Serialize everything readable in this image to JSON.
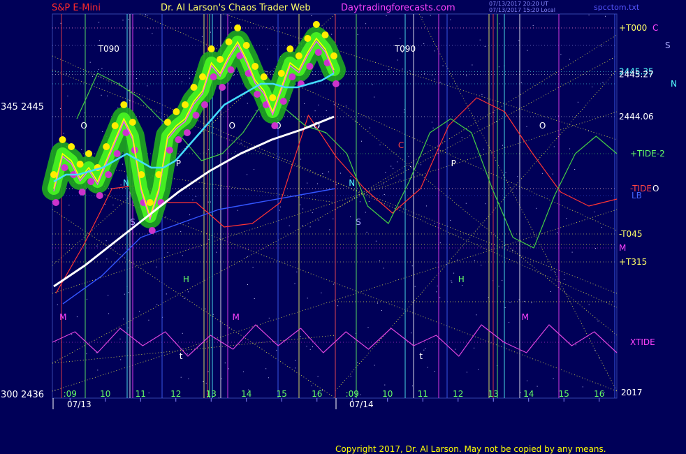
{
  "header": {
    "symbol": "S&P E-Mini",
    "symbol_color": "#ff2a2a",
    "title": "Dr. Al Larson's Chaos Trader Web",
    "title_color": "#ffff66",
    "site": "Daytradingforecasts.com",
    "site_color": "#ff44ff",
    "timestamp1": "07/13/2017 20:20 UT",
    "timestamp2": "07/13/2017 15:20 Local",
    "file": "spcctom.txt",
    "file_color": "#5555ff"
  },
  "left_prices": {
    "top_label": "345  2445",
    "bottom_label": "300  2436"
  },
  "copyright": "Copyright 2017, Dr. Al Larson. May not be copied by any means.",
  "chart_data": {
    "type": "line",
    "title": "S&P E-Mini",
    "ylim": [
      2436,
      2447
    ],
    "x_ticks": [
      ":09",
      "10",
      "11",
      "12",
      "13",
      "14",
      "15",
      "16",
      ":09",
      "10",
      "11",
      "12",
      "13",
      "14",
      "15",
      "16"
    ],
    "date_labels": [
      "07/13",
      "07/14"
    ],
    "year_label": "2017",
    "right_labels": [
      {
        "text": "+T000",
        "color": "#ffff66",
        "price": 2446.6
      },
      {
        "text": "C",
        "color": "#ff44ff",
        "price": 2446.6
      },
      {
        "text": "S",
        "color": "#aaaaff",
        "price": 2446.1
      },
      {
        "text": "2445.35",
        "color": "#55ffff",
        "price": 2445.35
      },
      {
        "text": "2445.27",
        "color": "#ffffff",
        "price": 2445.27
      },
      {
        "text": "N",
        "color": "#55ffff",
        "price": 2445.0
      },
      {
        "text": "2444.06",
        "color": "#ffffff",
        "price": 2444.06
      },
      {
        "text": "+TIDE-2",
        "color": "#66ff66",
        "price": 2443.0
      },
      {
        "text": "-TIDE",
        "color": "#ff4444",
        "price": 2442.0
      },
      {
        "text": "O",
        "color": "#ffffff",
        "price": 2442.0
      },
      {
        "text": "LB",
        "color": "#4466ff",
        "price": 2441.8
      },
      {
        "text": "-T045",
        "color": "#ffff66",
        "price": 2440.7
      },
      {
        "text": "M",
        "color": "#ff44ff",
        "price": 2440.3
      },
      {
        "text": "+T315",
        "color": "#ffff66",
        "price": 2439.9
      },
      {
        "text": "XTIDE",
        "color": "#ff44ff",
        "price": 2437.6
      }
    ],
    "series": [
      {
        "name": "Price",
        "color": "#ffff00",
        "values": [
          2442.0,
          2443.0,
          2442.8,
          2442.3,
          2442.6,
          2442.2,
          2442.8,
          2443.4,
          2444.0,
          2443.5,
          2442.0,
          2441.2,
          2442.0,
          2443.5,
          2443.8,
          2444.0,
          2444.5,
          2444.8,
          2445.6,
          2445.3,
          2445.8,
          2446.2,
          2445.7,
          2445.1,
          2444.8,
          2444.2,
          2444.9,
          2445.6,
          2445.4,
          2445.9,
          2446.3,
          2446.0,
          2445.4
        ]
      },
      {
        "name": "Average",
        "color": "#44ddff",
        "values": [
          2442.2,
          2442.4,
          2442.4,
          2442.5,
          2442.6,
          2442.8,
          2443.0,
          2442.8,
          2442.6,
          2442.6,
          2442.8,
          2443.2,
          2443.6,
          2444.0,
          2444.4,
          2444.6,
          2444.8,
          2445.0,
          2445.0,
          2444.9,
          2444.9,
          2445.0,
          2445.1,
          2445.3
        ]
      },
      {
        "name": "Trend",
        "color": "#ffffff",
        "values": [
          2439.2,
          2439.8,
          2440.5,
          2441.2,
          2441.9,
          2442.5,
          2443.0,
          2443.4,
          2443.7,
          2444.06
        ]
      },
      {
        "name": "+TIDE-2",
        "color": "#44cc44",
        "values": [
          2444.0,
          2445.3,
          2445.0,
          2444.6,
          2444.0,
          2443.5,
          2442.8,
          2443.0,
          2443.6,
          2444.5,
          2444.3,
          2443.8,
          2443.6,
          2443.0,
          2441.5,
          2441.0,
          2442.2,
          2443.6,
          2444.0,
          2443.6,
          2442.0,
          2440.6,
          2440.3,
          2441.8,
          2443.0,
          2443.5,
          2443.0
        ]
      },
      {
        "name": "-TIDE",
        "color": "#ff3333",
        "values": [
          2439.0,
          2440.4,
          2442.0,
          2442.1,
          2441.6,
          2441.6,
          2440.9,
          2441.0,
          2441.6,
          2444.1,
          2442.9,
          2442.0,
          2441.3,
          2442.0,
          2443.8,
          2444.6,
          2444.2,
          2443.0,
          2441.9,
          2441.5,
          2441.7
        ]
      },
      {
        "name": "LB",
        "color": "#3355ff",
        "values": [
          2438.7,
          2439.5,
          2440.6,
          2441.0,
          2441.4,
          2441.6,
          2441.8,
          2442.0
        ]
      },
      {
        "name": "XTIDE",
        "color": "#dd44dd",
        "values": [
          2437.6,
          2437.9,
          2437.3,
          2438.0,
          2437.5,
          2437.9,
          2437.2,
          2437.8,
          2437.4,
          2438.1,
          2437.5,
          2438.0,
          2437.3,
          2437.9,
          2437.4,
          2438.0,
          2437.5,
          2437.8,
          2437.2,
          2438.1,
          2437.6,
          2437.3,
          2438.1,
          2437.5,
          2437.9,
          2437.3
        ]
      }
    ],
    "vertical_markers": [
      {
        "label": "T090",
        "color": "#ffffff",
        "x": 1.3
      },
      {
        "label": "T090",
        "color": "#ffffff",
        "x": 9.7
      },
      {
        "label": "O",
        "color": "#ffffff",
        "x": 0.8
      },
      {
        "label": "O",
        "color": "#ffffff",
        "x": 5.0
      },
      {
        "label": "O",
        "color": "#ffffff",
        "x": 6.3
      },
      {
        "label": "O",
        "color": "#ffffff",
        "x": 7.4
      },
      {
        "label": "O",
        "color": "#ffffff",
        "x": 13.8
      },
      {
        "label": "N",
        "color": "#55ffff",
        "x": 2.0
      },
      {
        "label": "N",
        "color": "#55ffff",
        "x": 8.4
      },
      {
        "label": "S",
        "color": "#aaaaff",
        "x": 2.2
      },
      {
        "label": "S",
        "color": "#aaaaff",
        "x": 8.6
      },
      {
        "label": "P",
        "color": "#ffffff",
        "x": 3.5
      },
      {
        "label": "P",
        "color": "#ffffff",
        "x": 11.3
      },
      {
        "label": "H",
        "color": "#66ff66",
        "x": 3.7
      },
      {
        "label": "H",
        "color": "#66ff66",
        "x": 11.5
      },
      {
        "label": "C",
        "color": "#ff4444",
        "x": 9.8
      },
      {
        "label": "M",
        "color": "#ff44ff",
        "x": 0.2
      },
      {
        "label": "M",
        "color": "#ff44ff",
        "x": 5.1
      },
      {
        "label": "M",
        "color": "#ff44ff",
        "x": 13.3
      },
      {
        "label": "t",
        "color": "#ffffff",
        "x": 3.6
      },
      {
        "label": "t",
        "color": "#ffffff",
        "x": 10.4
      }
    ]
  }
}
